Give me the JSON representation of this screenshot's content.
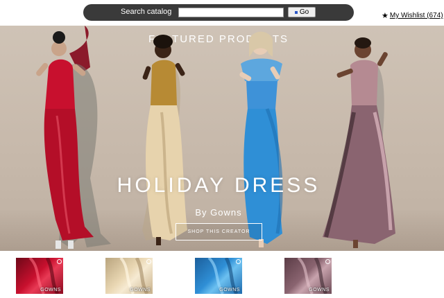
{
  "search": {
    "label": "Search catalog",
    "placeholder": "",
    "value": "",
    "go_label": "Go"
  },
  "wishlist": {
    "label": "My Wishlist (674)",
    "icon": "star-icon"
  },
  "banner": {
    "heading": "FEATURED PRODUCTS",
    "title": "HOLIDAY DRESS",
    "subtitle": "By Gowns",
    "cta_label": "SHOP THIS CREATOR"
  },
  "thumbnails": [
    {
      "brand": "GOWNS",
      "color": "#c8102e"
    },
    {
      "brand": "GOWNS",
      "color": "#d8c19a"
    },
    {
      "brand": "GOWNS",
      "color": "#2f8fd6"
    },
    {
      "brand": "GOWNS",
      "color": "#8a6470"
    }
  ],
  "colors": {
    "search_bar": "#3a3a3a",
    "banner_bg": "#c7b9ab",
    "dress_red": "#c8102e",
    "dress_gold": "#d8c19a",
    "dress_blue": "#2f8fd6",
    "dress_mauve": "#8a6470"
  }
}
